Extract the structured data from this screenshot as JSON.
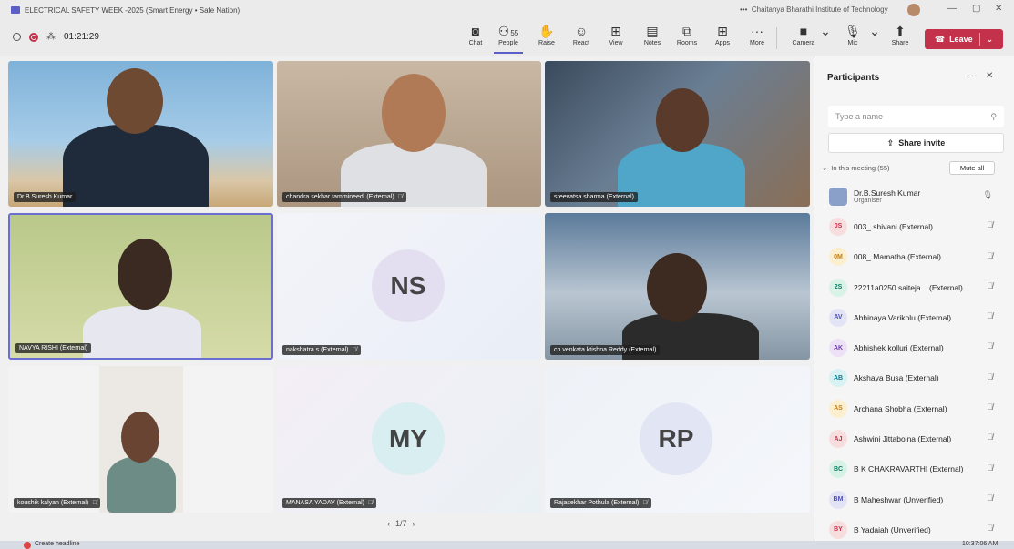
{
  "window": {
    "title": "ELECTRICAL SAFETY WEEK -2025 (Smart Energy • Safe Nation)",
    "organization": "Chaitanya Bharathi Institute of Technology",
    "more": "•••"
  },
  "toolbar": {
    "timer": "01:21:29",
    "buttons": {
      "chat": "Chat",
      "people": "People",
      "people_count": "55",
      "raise": "Raise",
      "react": "React",
      "view": "View",
      "notes": "Notes",
      "rooms": "Rooms",
      "apps": "Apps",
      "more": "More",
      "camera": "Camera",
      "mic": "Mic",
      "share": "Share"
    },
    "leave_label": "Leave"
  },
  "tiles": [
    {
      "name": "Dr.B.Suresh Kumar",
      "type": "video",
      "muted": false
    },
    {
      "name": "chandra sekhar tammineedi (External)",
      "type": "video",
      "muted": true
    },
    {
      "name": "sreevatsa sharma (External)",
      "type": "video",
      "muted": false
    },
    {
      "name": "NAVYA RISHI (External)",
      "type": "video",
      "muted": false
    },
    {
      "name": "nakshatra s (External)",
      "type": "initials",
      "initials": "NS",
      "muted": true
    },
    {
      "name": "ch venkata ktishna Reddy (External)",
      "type": "video",
      "muted": false
    },
    {
      "name": "koushik kalyan (External)",
      "type": "video",
      "muted": true
    },
    {
      "name": "MANASA YADAV (External)",
      "type": "initials",
      "initials": "MY",
      "muted": true
    },
    {
      "name": "Rajasekhar Pothula (External)",
      "type": "initials",
      "initials": "RP",
      "muted": true
    }
  ],
  "pager": {
    "label": "1/7",
    "prev": "‹",
    "next": "›"
  },
  "panel": {
    "title": "Participants",
    "search_placeholder": "Type a name",
    "share_invite": "Share invite",
    "in_meeting": "In this meeting (55)",
    "mute_all": "Mute all",
    "participants": [
      {
        "initials": "",
        "name": "Dr.B.Suresh Kumar",
        "role": "Organiser",
        "color": "#5b5fc7",
        "bg": "#dfe3f7",
        "mic": "on"
      },
      {
        "initials": "0S",
        "name": "003_ shivani (External)",
        "color": "#c4314b",
        "bg": "#f6dede",
        "mic": "off"
      },
      {
        "initials": "0M",
        "name": "008_ Mamatha (External)",
        "color": "#c27c0e",
        "bg": "#fcefd0",
        "mic": "off"
      },
      {
        "initials": "2S",
        "name": "22211a0250 saiteja... (External)",
        "color": "#0e7a5c",
        "bg": "#d9f2e8",
        "mic": "off"
      },
      {
        "initials": "AV",
        "name": "Abhinaya Varikolu (External)",
        "color": "#4f52b2",
        "bg": "#e2e3f5",
        "mic": "off"
      },
      {
        "initials": "AK",
        "name": "Abhishek kolluri (External)",
        "color": "#6b3fa0",
        "bg": "#ece1f7",
        "mic": "off"
      },
      {
        "initials": "AB",
        "name": "Akshaya Busa (External)",
        "color": "#0e7a8a",
        "bg": "#d8f1f3",
        "mic": "off"
      },
      {
        "initials": "AS",
        "name": "Archana Shobha (External)",
        "color": "#c27c0e",
        "bg": "#fcefd0",
        "mic": "off"
      },
      {
        "initials": "AJ",
        "name": "Ashwini Jittaboina (External)",
        "color": "#c4314b",
        "bg": "#f6dede",
        "mic": "off"
      },
      {
        "initials": "BC",
        "name": "B K CHAKRAVARTHI (External)",
        "color": "#0e7a5c",
        "bg": "#d9f2e8",
        "mic": "off"
      },
      {
        "initials": "BM",
        "name": "B Maheshwar (Unverified)",
        "color": "#4f52b2",
        "bg": "#e2e3f5",
        "mic": "off"
      },
      {
        "initials": "BY",
        "name": "B Yadaiah (Unverified)",
        "color": "#c4314b",
        "bg": "#f6dede",
        "mic": "off"
      }
    ]
  },
  "taskbar": {
    "search_text": "Create headline",
    "clock": "10:37:06 AM"
  }
}
